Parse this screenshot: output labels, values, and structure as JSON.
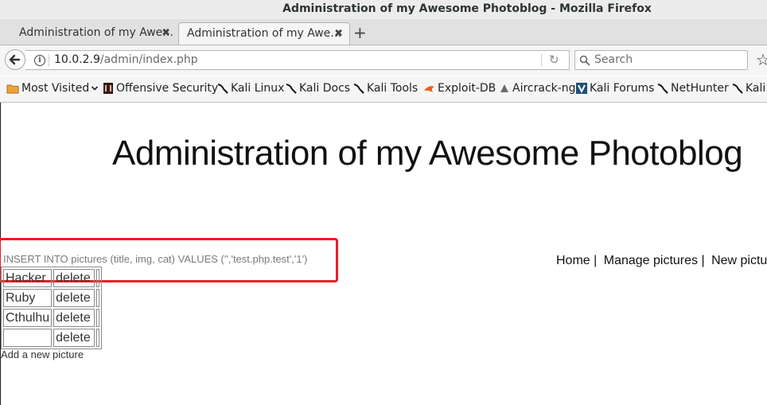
{
  "window": {
    "title": "Administration of my Awesome Photoblog - Mozilla Firefox"
  },
  "tabs": [
    {
      "label": "Administration of my Awe…",
      "close": "✖"
    },
    {
      "label": "Administration of my Awe…",
      "close": "✖"
    }
  ],
  "new_tab": "+",
  "nav": {
    "url_host": "10.0.2.9",
    "url_path": "/admin/index.php",
    "search_placeholder": "Search"
  },
  "bookmarks": [
    {
      "label": "Most Visited",
      "icon": "folder-icon"
    },
    {
      "label": "Offensive Security",
      "icon": "offsec-icon"
    },
    {
      "label": "Kali Linux",
      "icon": "kali-dragon-icon"
    },
    {
      "label": "Kali Docs",
      "icon": "kali-dragon-icon"
    },
    {
      "label": "Kali Tools",
      "icon": "kali-dragon-icon"
    },
    {
      "label": "Exploit-DB",
      "icon": "exploitdb-icon"
    },
    {
      "label": "Aircrack-ng",
      "icon": "aircrack-icon"
    },
    {
      "label": "Kali Forums",
      "icon": "kali-forums-icon"
    },
    {
      "label": "NetHunter",
      "icon": "kali-dragon-icon"
    },
    {
      "label": "Kali",
      "icon": "kali-dragon-icon"
    }
  ],
  "page": {
    "heading": "Administration of my Awesome Photoblog",
    "sql_query": "INSERT INTO pictures (title, img, cat) VALUES ('','test.php.test','1')",
    "top_nav": [
      "Home |",
      "Manage pictures |",
      "New picture"
    ],
    "pictures": [
      {
        "title": "Hacker",
        "action": "delete"
      },
      {
        "title": "Ruby",
        "action": "delete"
      },
      {
        "title": "Cthulhu",
        "action": "delete"
      },
      {
        "title": "",
        "action": "delete"
      }
    ],
    "add_link": "Add a new picture"
  },
  "colors": {
    "highlight": "#ee1b24"
  }
}
